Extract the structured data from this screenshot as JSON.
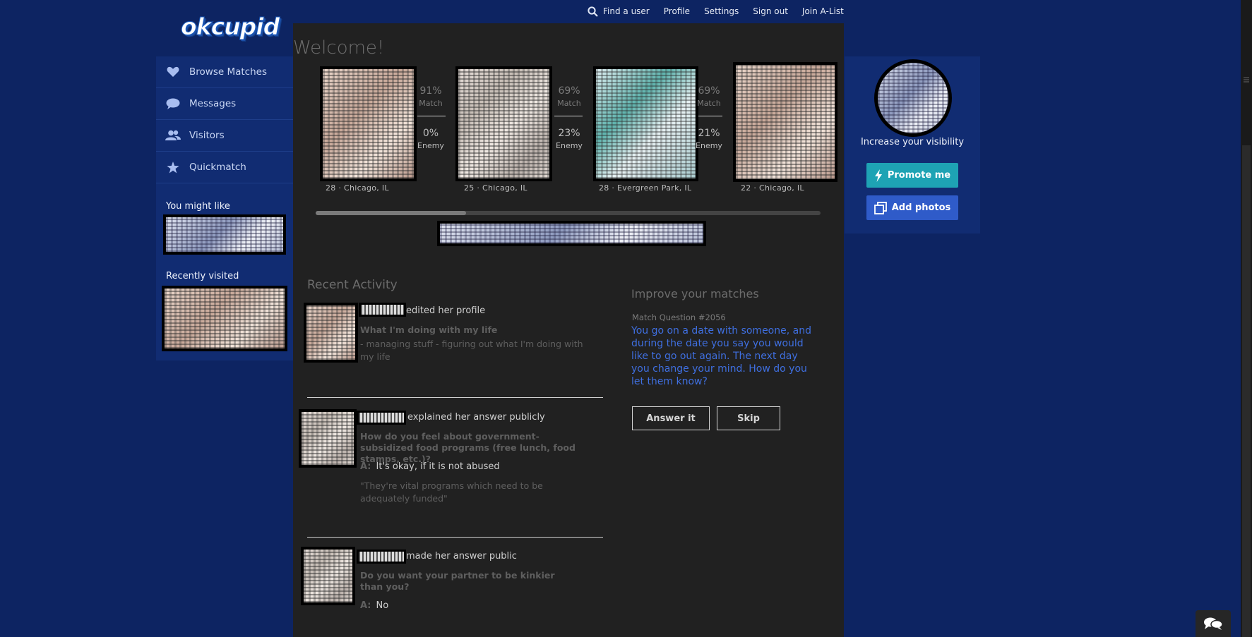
{
  "app": {
    "logo_text": "okcupid"
  },
  "topnav": {
    "find": "Find a user",
    "profile": "Profile",
    "settings": "Settings",
    "signout": "Sign out",
    "alist": "Join A-List"
  },
  "welcome": "Welcome!",
  "sidebar": {
    "items": [
      {
        "label": "Browse Matches",
        "icon": "heart-icon"
      },
      {
        "label": "Messages",
        "icon": "speech-bubble-icon"
      },
      {
        "label": "Visitors",
        "icon": "people-icon"
      },
      {
        "label": "Quickmatch",
        "icon": "star-icon"
      }
    ],
    "you_might_like": "You might like",
    "recently_visited": "Recently visited"
  },
  "matches": [
    {
      "match": "91%",
      "match_label": "Match",
      "enemy": "0%",
      "enemy_label": "Enemy",
      "location": "28 · Chicago, IL"
    },
    {
      "match": "69%",
      "match_label": "Match",
      "enemy": "23%",
      "enemy_label": "Enemy",
      "location": "25 · Chicago, IL"
    },
    {
      "match": "69%",
      "match_label": "Match",
      "enemy": "21%",
      "enemy_label": "Enemy",
      "location": "28 · Evergreen Park, IL"
    },
    {
      "location": "22 · Chicago, IL"
    }
  ],
  "recent": {
    "title": "Recent Activity",
    "items": [
      {
        "action": "edited her profile",
        "question": "What I'm doing with my life",
        "answer": "- managing stuff - figuring out what I'm doing with my life"
      },
      {
        "action": "explained her answer publicly",
        "question": "How do you feel about government-subsidized food programs (free lunch, food stamps, etc.)?",
        "a_label": "A:",
        "a_value": "It's okay, if it is not abused",
        "explanation": "\"They're vital programs which need to be adequately funded\""
      },
      {
        "action": "made her answer public",
        "question": "Do you want your partner to be kinkier than you?",
        "a_label": "A:",
        "a_value": "No"
      }
    ]
  },
  "improve": {
    "title": "Improve your matches",
    "question_label": "Match Question #2056",
    "question_text": "You go on a date with someone, and during the date you say you would like to go out again. The next day you change your mind. How do you let them know?",
    "answer_button": "Answer it",
    "skip_button": "Skip"
  },
  "right": {
    "visibility": "Increase your visibility",
    "promote": "Promote me",
    "add_photos": "Add photos"
  },
  "colors": {
    "page_bg": "#0d2462",
    "panel_bg": "#112c72",
    "main_bg": "#212121",
    "promote": "#1ea3b4",
    "add_photos": "#2f5bc9",
    "link_blue": "#3f6fe0"
  }
}
